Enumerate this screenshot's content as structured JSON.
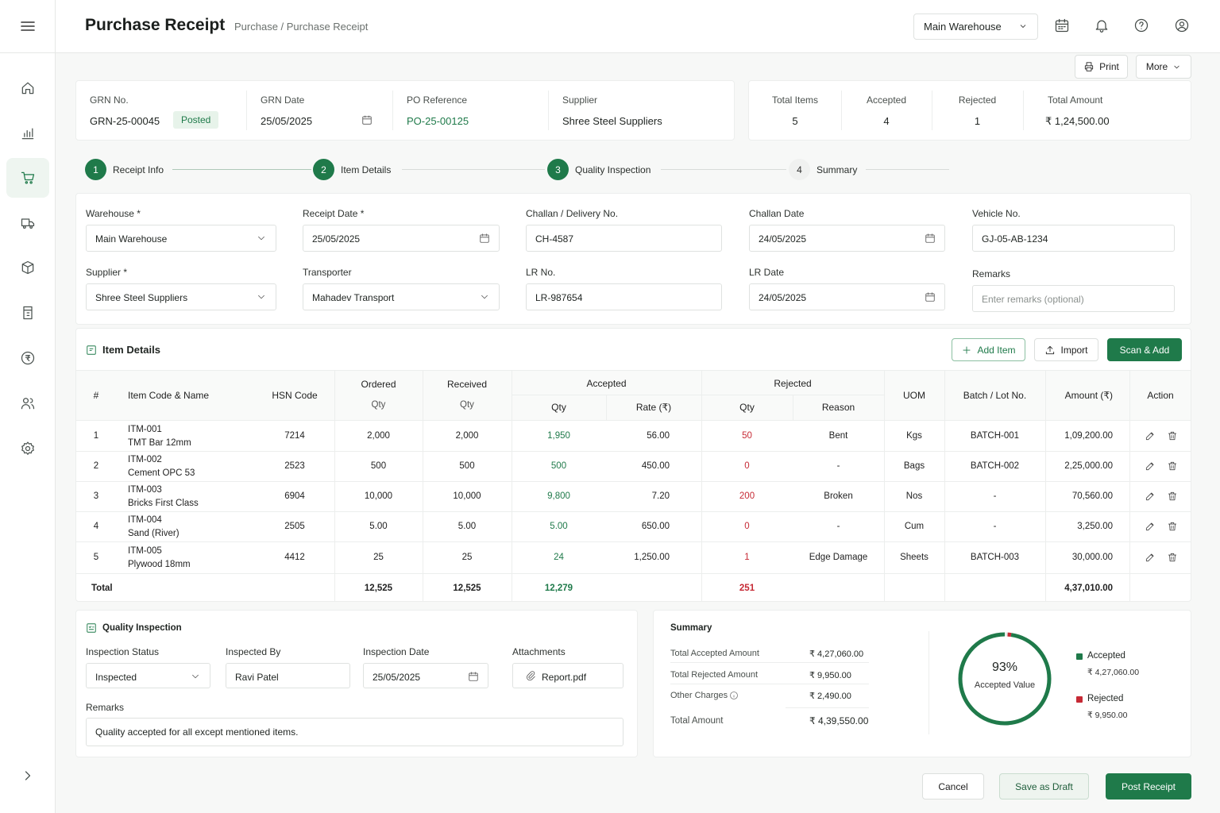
{
  "page": {
    "title": "Purchase Receipt",
    "breadcrumb": "Purchase / Purchase Receipt"
  },
  "header": {
    "warehouse_select": "Main Warehouse",
    "icons": [
      "calendar-icon",
      "bell-icon",
      "help-icon",
      "user-icon"
    ]
  },
  "actions": {
    "print": "Print",
    "more": "More"
  },
  "grn": {
    "grn_no_label": "GRN No.",
    "grn_no": "GRN-25-00045",
    "status": "Posted",
    "grn_date_label": "GRN Date",
    "grn_date": "25/05/2025",
    "po_label": "PO Reference",
    "po": "PO-25-00125",
    "supplier_label": "Supplier",
    "supplier": "Shree Steel Suppliers"
  },
  "stats": [
    {
      "label": "Total Items",
      "value": "5"
    },
    {
      "label": "Accepted",
      "value": "4"
    },
    {
      "label": "Rejected",
      "value": "1"
    },
    {
      "label": "Total Amount",
      "value": "₹ 1,24,500.00"
    }
  ],
  "steps": [
    {
      "num": "1",
      "label": "Receipt Info"
    },
    {
      "num": "2",
      "label": "Item Details"
    },
    {
      "num": "3",
      "label": "Quality Inspection"
    },
    {
      "num": "4",
      "label": "Summary"
    }
  ],
  "form": {
    "warehouse_label": "Warehouse *",
    "warehouse": "Main Warehouse",
    "receipt_date_label": "Receipt Date *",
    "receipt_date": "25/05/2025",
    "challan_no_label": "Challan / Delivery No.",
    "challan_no": "CH-4587",
    "challan_date_label": "Challan Date",
    "challan_date": "24/05/2025",
    "vehicle_label": "Vehicle No.",
    "vehicle": "GJ-05-AB-1234",
    "supplier_label": "Supplier *",
    "supplier": "Shree Steel Suppliers",
    "transporter_label": "Transporter",
    "transporter": "Mahadev Transport",
    "lr_no_label": "LR No.",
    "lr_no": "LR-987654",
    "lr_date_label": "LR Date",
    "lr_date": "24/05/2025",
    "remarks_label": "Remarks",
    "remarks_placeholder": "Enter remarks (optional)"
  },
  "items_section": {
    "title": "Item Details",
    "add_item": "Add Item",
    "import": "Import",
    "scan_add": "Scan & Add",
    "headers": {
      "num": "#",
      "item": "Item Code & Name",
      "hsn": "HSN Code",
      "ordered": "Ordered",
      "ordered_sub": "Qty",
      "received": "Received",
      "received_sub": "Qty",
      "accepted": "Accepted",
      "acc_qty": "Qty",
      "acc_rate": "Rate (₹)",
      "rejected": "Rejected",
      "rej_qty": "Qty",
      "rej_reason": "Reason",
      "uom": "UOM",
      "batch": "Batch / Lot No.",
      "amount": "Amount (₹)",
      "action": "Action"
    },
    "rows": [
      {
        "num": "1",
        "code": "ITM-001",
        "name": "TMT Bar 12mm",
        "hsn": "7214",
        "ordered": "2,000",
        "received": "2,000",
        "acc_qty": "1,950",
        "rate": "56.00",
        "rej_qty": "50",
        "reason": "Bent",
        "uom": "Kgs",
        "batch": "BATCH-001",
        "amount": "1,09,200.00"
      },
      {
        "num": "2",
        "code": "ITM-002",
        "name": "Cement OPC 53",
        "hsn": "2523",
        "ordered": "500",
        "received": "500",
        "acc_qty": "500",
        "rate": "450.00",
        "rej_qty": "0",
        "reason": "-",
        "uom": "Bags",
        "batch": "BATCH-002",
        "amount": "2,25,000.00"
      },
      {
        "num": "3",
        "code": "ITM-003",
        "name": "Bricks First Class",
        "hsn": "6904",
        "ordered": "10,000",
        "received": "10,000",
        "acc_qty": "9,800",
        "rate": "7.20",
        "rej_qty": "200",
        "reason": "Broken",
        "uom": "Nos",
        "batch": "-",
        "amount": "70,560.00"
      },
      {
        "num": "4",
        "code": "ITM-004",
        "name": "Sand (River)",
        "hsn": "2505",
        "ordered": "5.00",
        "received": "5.00",
        "acc_qty": "5.00",
        "rate": "650.00",
        "rej_qty": "0",
        "reason": "-",
        "uom": "Cum",
        "batch": "-",
        "amount": "3,250.00"
      },
      {
        "num": "5",
        "code": "ITM-005",
        "name": "Plywood 18mm",
        "hsn": "4412",
        "ordered": "25",
        "received": "25",
        "acc_qty": "24",
        "rate": "1,250.00",
        "rej_qty": "1",
        "reason": "Edge Damage",
        "uom": "Sheets",
        "batch": "BATCH-003",
        "amount": "30,000.00"
      }
    ],
    "total": {
      "label": "Total",
      "ordered": "12,525",
      "received": "12,525",
      "acc_qty": "12,279",
      "rej_qty": "251",
      "amount": "4,37,010.00"
    }
  },
  "quality": {
    "title": "Quality Inspection",
    "status_label": "Inspection Status",
    "status": "Inspected",
    "by_label": "Inspected By",
    "by": "Ravi Patel",
    "date_label": "Inspection Date",
    "date": "25/05/2025",
    "attach_label": "Attachments",
    "attach": "Report.pdf",
    "remarks_label": "Remarks",
    "remarks": "Quality accepted for all except mentioned items."
  },
  "summary": {
    "title": "Summary",
    "rows": [
      {
        "label": "Total Accepted Amount",
        "value": "₹ 4,27,060.00"
      },
      {
        "label": "Total Rejected Amount",
        "value": "₹ 9,950.00"
      },
      {
        "label": "Other Charges",
        "value": "₹ 2,490.00"
      }
    ],
    "total_label": "Total Amount",
    "total_value": "₹ 4,39,550.00",
    "donut_percent": "93%",
    "donut_caption": "Accepted Value",
    "accepted_fraction": 0.977,
    "legend": [
      {
        "label": "Accepted",
        "value": "₹ 4,27,060.00",
        "color": "#1f7a4a"
      },
      {
        "label": "Rejected",
        "value": "₹ 9,950.00",
        "color": "#c62a35"
      }
    ]
  },
  "footer": {
    "cancel": "Cancel",
    "draft": "Save as Draft",
    "post": "Post Receipt"
  },
  "colors": {
    "accent": "#1f7a4a",
    "danger": "#c62a35"
  }
}
